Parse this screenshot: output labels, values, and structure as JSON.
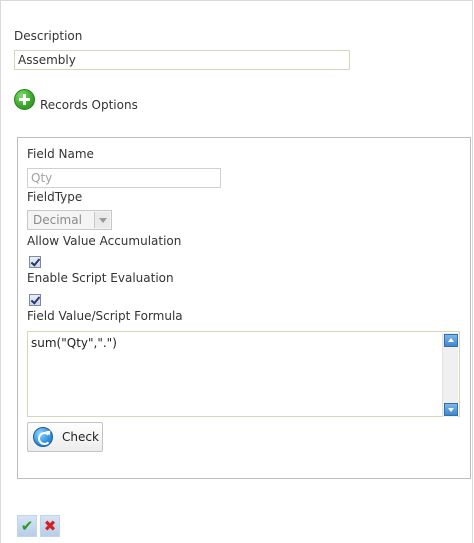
{
  "form": {
    "description_label": "Description",
    "description_value": "Assembly",
    "records_options_label": "Records Options"
  },
  "records": {
    "field_name_label": "Field Name",
    "field_name_placeholder": "Qty",
    "field_type_label": "FieldType",
    "field_type_value": "Decimal",
    "allow_accumulation_label": "Allow Value Accumulation",
    "allow_accumulation_checked": true,
    "enable_script_label": "Enable Script Evaluation",
    "enable_script_checked": true,
    "formula_label": "Field Value/Script Formula",
    "formula_value": "sum(\"Qty\",\".\")",
    "check_button_label": "Check"
  },
  "footer": {
    "ok_glyph": "✔",
    "cancel_glyph": "✖"
  },
  "icons": {
    "add": "add-circle-icon",
    "refresh": "refresh-icon",
    "ok": "checkmark-icon",
    "cancel": "close-icon"
  },
  "colors": {
    "accent_green": "#3aa92a",
    "accent_blue": "#2f8fe0",
    "cancel_red": "#d42020"
  }
}
